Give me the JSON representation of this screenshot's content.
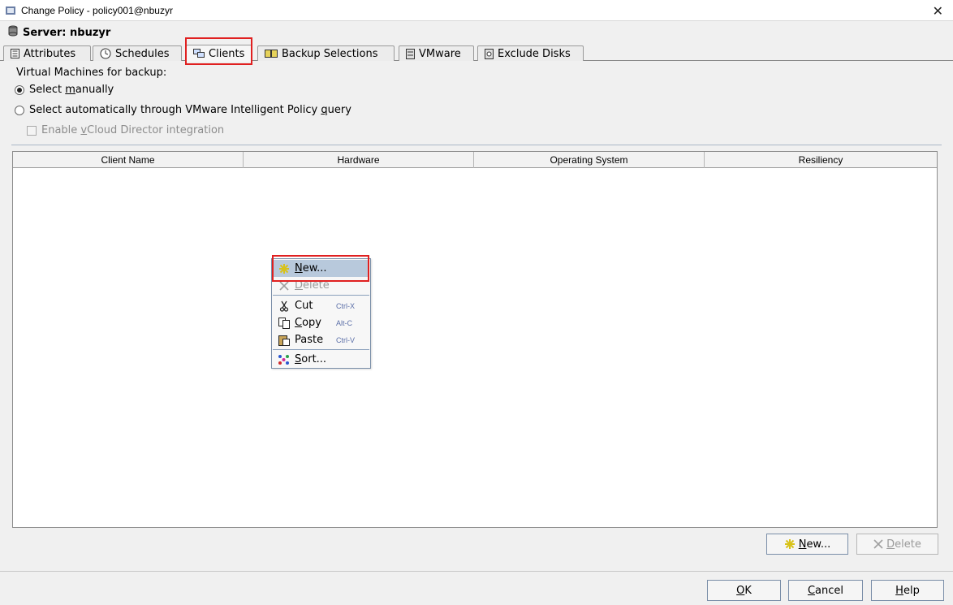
{
  "window": {
    "title": "Change Policy - policy001@nbuzyr",
    "close_glyph": "✕"
  },
  "server": {
    "label": "Server: nbuzyr"
  },
  "tabs": [
    {
      "label": "Attributes",
      "icon": "list-icon"
    },
    {
      "label": "Schedules",
      "icon": "clock-gear-icon"
    },
    {
      "label": "Clients",
      "icon": "computers-icon",
      "active": true
    },
    {
      "label": "Backup Selections",
      "icon": "folders-icon"
    },
    {
      "label": "VMware",
      "icon": "server-icon"
    },
    {
      "label": "Exclude Disks",
      "icon": "disk-icon"
    }
  ],
  "vm_section": {
    "heading": "Virtual Machines for backup:",
    "radio_manual_pre": "Select ",
    "radio_manual_u": "m",
    "radio_manual_post": "anually",
    "radio_auto_pre": "Select automatically through VMware Intelligent Policy ",
    "radio_auto_u": "q",
    "radio_auto_post": "uery",
    "vcloud_pre": "Enable ",
    "vcloud_u": "v",
    "vcloud_post": "Cloud Director integration"
  },
  "table": {
    "columns": [
      "Client Name",
      "Hardware",
      "Operating System",
      "Resiliency"
    ]
  },
  "context_menu": {
    "new_u": "N",
    "new_post": "ew...",
    "delete_u": "D",
    "delete_post": "elete",
    "cut": "Cut",
    "cut_shortcut": "Ctrl-X",
    "copy_u": "C",
    "copy_post": "opy",
    "copy_shortcut": "Alt-C",
    "paste": "Paste",
    "paste_shortcut": "Ctrl-V",
    "sort_u": "S",
    "sort_post": "ort..."
  },
  "table_buttons": {
    "new_u": "N",
    "new_post": "ew...",
    "delete_u": "D",
    "delete_post": "elete"
  },
  "dialog_buttons": {
    "ok_u": "O",
    "ok_post": "K",
    "cancel_u": "C",
    "cancel_post": "ancel",
    "help_u": "H",
    "help_post": "elp"
  },
  "colors": {
    "highlight": "#e02020",
    "menu_selected": "#b8c9dc",
    "new_star": "#d8c21a"
  }
}
